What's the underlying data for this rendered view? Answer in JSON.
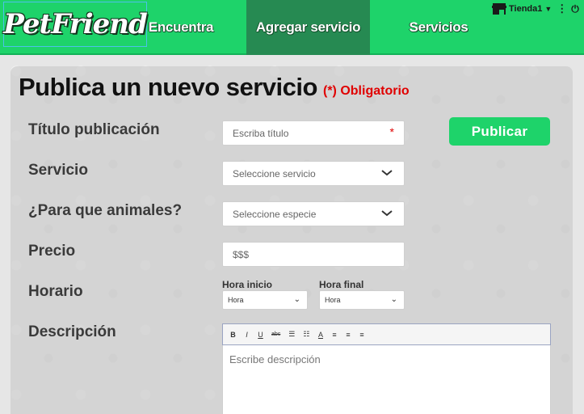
{
  "header": {
    "logo_text": "PetFriend",
    "nav": {
      "encuentra": "Encuentra",
      "agregar": "Agregar servicio",
      "servicios": "Servicios"
    },
    "store_name": "Tienda1",
    "accent_color": "#1ed36a",
    "active_nav_color": "#268a52"
  },
  "form": {
    "title": "Publica un nuevo servicio",
    "required_note": "(*) Obligatorio",
    "publish_label": "Publicar",
    "titulo": {
      "label": "Título publicación",
      "placeholder": "Escriba título",
      "required_mark": "*"
    },
    "servicio": {
      "label": "Servicio",
      "placeholder": "Seleccione servicio"
    },
    "animales": {
      "label": "¿Para que animales?",
      "placeholder": "Seleccione especie"
    },
    "precio": {
      "label": "Precio",
      "placeholder": "$$$"
    },
    "horario": {
      "label": "Horario",
      "inicio_label": "Hora inicio",
      "inicio_value": "Hora",
      "final_label": "Hora final",
      "final_value": "Hora"
    },
    "descripcion": {
      "label": "Descripción",
      "placeholder": "Escribe descripción",
      "toolbar": [
        "B",
        "I",
        "U",
        "abc",
        "☰",
        "☷",
        "A",
        "≡",
        "≡",
        "≡"
      ]
    }
  }
}
